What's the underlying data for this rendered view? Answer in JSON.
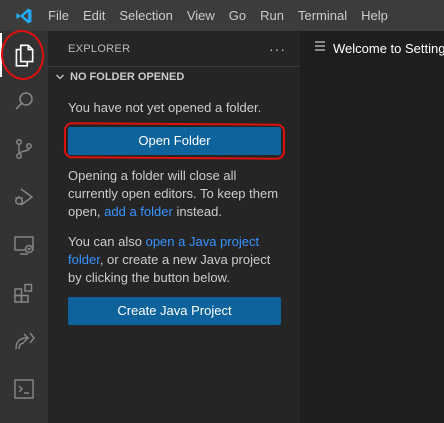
{
  "menu": [
    "File",
    "Edit",
    "Selection",
    "View",
    "Go",
    "Run",
    "Terminal",
    "Help"
  ],
  "activity_bar": {
    "icons": [
      "files-icon",
      "search-icon",
      "source-control-icon",
      "run-debug-icon",
      "remote-explorer-icon",
      "extensions-icon",
      "live-share-icon",
      "terminal-icon"
    ],
    "active": "files-icon"
  },
  "sidebar": {
    "title": "EXPLORER",
    "more": "···",
    "section_title": "NO FOLDER OPENED",
    "no_folder_text": "You have not yet opened a folder.",
    "open_folder_button": "Open Folder",
    "opening_note_before": "Opening a folder will close all currently open editors. To keep them open, ",
    "opening_note_link": "add a folder",
    "opening_note_after": " instead.",
    "java_note_before": "You can also ",
    "java_note_link": "open a Java project folder",
    "java_note_after": ", or create a new Java project by clicking the button below.",
    "create_java_button": "Create Java Project"
  },
  "editor": {
    "tab_label": "Welcome to Settings"
  },
  "colors": {
    "accent": "#0e639c",
    "link": "#3794ff",
    "annotation": "#e01010",
    "logo": "#23a9f2"
  }
}
